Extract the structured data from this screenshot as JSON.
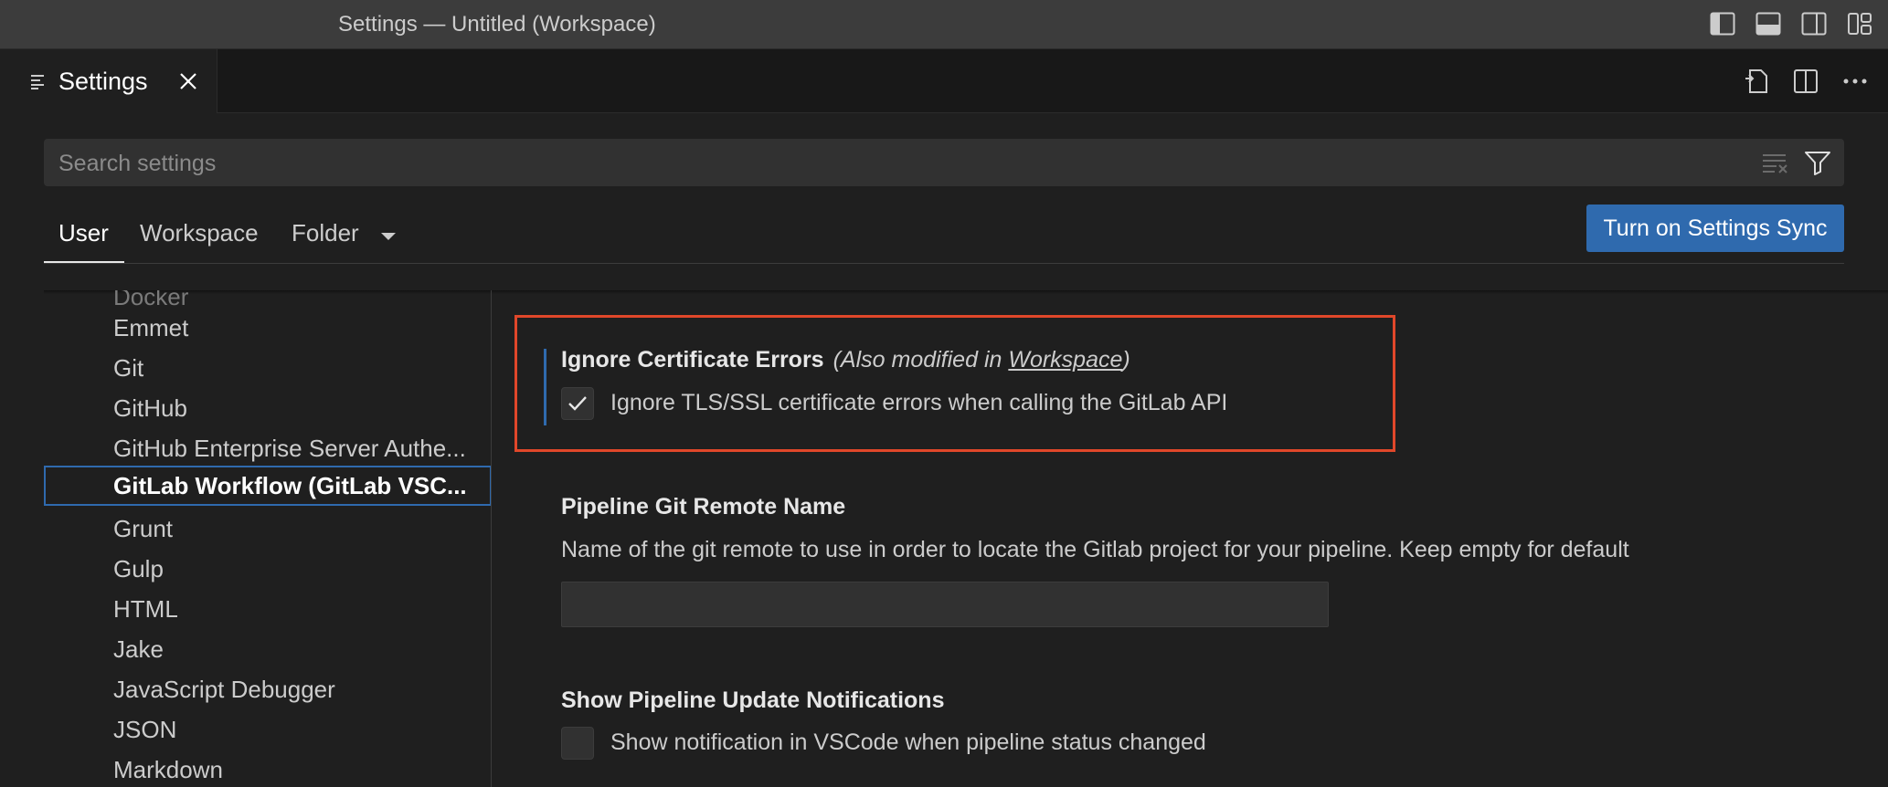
{
  "window": {
    "title": "Settings — Untitled (Workspace)",
    "layout_icons": [
      "toggle-primary-sidebar-icon",
      "toggle-panel-icon",
      "toggle-secondary-sidebar-icon",
      "customize-layout-icon"
    ]
  },
  "editor": {
    "tab_label": "Settings",
    "actions": [
      "open-settings-json-icon",
      "split-editor-icon",
      "more-actions-icon"
    ]
  },
  "search": {
    "placeholder": "Search settings",
    "value": ""
  },
  "scopes": {
    "tabs": [
      {
        "label": "User",
        "active": true
      },
      {
        "label": "Workspace",
        "active": false
      },
      {
        "label": "Folder",
        "active": false
      }
    ],
    "sync_button": "Turn on Settings Sync"
  },
  "toc": {
    "items": [
      {
        "label": "Docker"
      },
      {
        "label": "Emmet"
      },
      {
        "label": "Git"
      },
      {
        "label": "GitHub"
      },
      {
        "label": "GitHub Enterprise Server Authe..."
      },
      {
        "label": "GitLab Workflow (GitLab VSC..."
      },
      {
        "label": "Grunt"
      },
      {
        "label": "Gulp"
      },
      {
        "label": "HTML"
      },
      {
        "label": "Jake"
      },
      {
        "label": "JavaScript Debugger"
      },
      {
        "label": "JSON"
      },
      {
        "label": "Markdown"
      }
    ],
    "selected": "GitLab Workflow (GitLab VSC..."
  },
  "settings": {
    "ignore_cert": {
      "title": "Ignore Certificate Errors",
      "note_prefix": "(Also modified in ",
      "note_link": "Workspace",
      "note_suffix": ")",
      "description": "Ignore TLS/SSL certificate errors when calling the GitLab API",
      "checked": true
    },
    "pipeline_remote": {
      "title": "Pipeline Git Remote Name",
      "description": "Name of the git remote to use in order to locate the Gitlab project for your pipeline. Keep empty for default",
      "value": ""
    },
    "pipeline_notifications": {
      "title": "Show Pipeline Update Notifications",
      "description": "Show notification in VSCode when pipeline status changed",
      "checked": false
    }
  },
  "colors": {
    "accent": "#2f6aae",
    "highlight_border": "#e0472a",
    "background": "#1f1f1f"
  }
}
